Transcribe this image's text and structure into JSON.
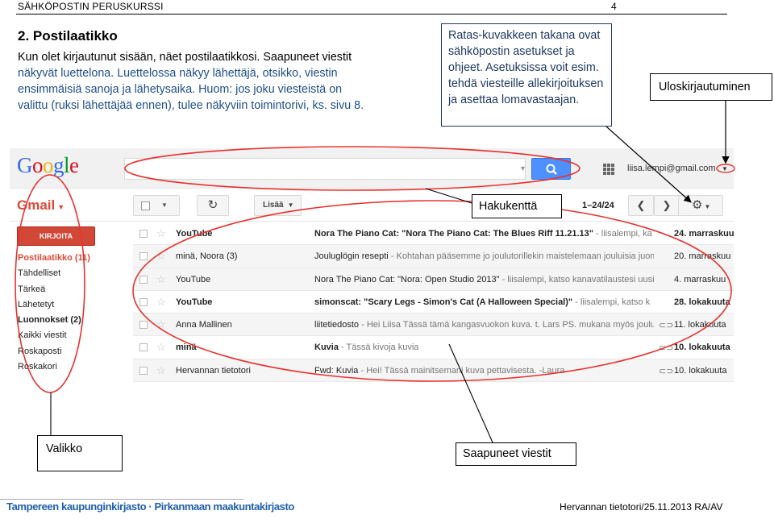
{
  "document": {
    "header_left": "SÄHKÖPOSTIN PERUSKURSSI",
    "page_number": "4",
    "section_title": "2. Postilaatikko",
    "intro_lines": [
      "Kun olet kirjautunut sisään, näet postilaatikkosi. Saapuneet viestit",
      "näkyvät luettelona. Luettelossa näkyy lähettäjä, otsikko, viestin",
      "ensimmäisiä sanoja ja lähetysaika. Huom: jos joku viesteistä on",
      "valittu (ruksi  lähettäjää ennen), tulee näkyviin toimintorivi, ks. sivu 8."
    ],
    "footer_left": "Tampereen kaupunginkirjasto · Pirkanmaan maakuntakirjasto",
    "footer_right": "Hervannan tietotori/25.11.2013 RA/AV"
  },
  "callouts": {
    "ratas": "Ratas-kuvakkeen takana ovat sähköpostin asetukset ja ohjeet. Asetuksissa voit esim. tehdä viesteille allekirjoituksen ja asettaa lomavastaajan.",
    "uloskirjautuminen": "Uloskirjautuminen",
    "hakukentta": "Hakukenttä",
    "valikko": "Valikko",
    "saapuneet": "Saapuneet viestit"
  },
  "gmail": {
    "logo": {
      "g1": "G",
      "o1": "o",
      "o2": "o",
      "g2": "g",
      "l": "l",
      "e": "e"
    },
    "account_email": "liisa.lempi@gmail.com",
    "product_label": "Gmail",
    "more_label": "Lisää",
    "page_count": "1–24/24",
    "compose_label": "KIRJOITA",
    "nav": [
      {
        "label": "Postilaatikko (11)",
        "state": "active"
      },
      {
        "label": "Tähdelliset",
        "state": ""
      },
      {
        "label": "Tärkeä",
        "state": ""
      },
      {
        "label": "Lähetetyt",
        "state": ""
      },
      {
        "label": "Luonnokset (2)",
        "state": "bold"
      },
      {
        "label": "Kaikki viestit",
        "state": ""
      },
      {
        "label": "Roskaposti",
        "state": ""
      },
      {
        "label": "Roskakori",
        "state": ""
      }
    ],
    "messages": [
      {
        "sender": "YouTube",
        "subject": "Nora The Piano Cat: \"Nora The Piano Cat: The Blues Riff 11.21.13\"",
        "snippet": " - liisalempi, ka",
        "date": "24. marraskuu",
        "unread": true,
        "attachment": false
      },
      {
        "sender": "minä, Noora (3)",
        "subject": "Jouluglögin resepti",
        "snippet": " - Kohtahan pääsemme jo joulutorillekin maistelemaan jouluisia juomia",
        "date": "20. marraskuu",
        "unread": false,
        "attachment": false
      },
      {
        "sender": "YouTube",
        "subject": "Nora The Piano Cat: \"Nora: Open Studio 2013\"",
        "snippet": " - liisalempi, katso kanavatilaustesi uusimmat",
        "date": "4. marraskuu",
        "unread": false,
        "attachment": false
      },
      {
        "sender": "YouTube",
        "subject": "simonscat: \"Scary Legs - Simon's Cat (A Halloween Special)\"",
        "snippet": " - liisalempi, katso k",
        "date": "28. lokakuuta",
        "unread": true,
        "attachment": false
      },
      {
        "sender": "Anna Mallinen",
        "subject": "liitetiedosto",
        "snippet": " - Hei Liisa Tässä tämä kangasvuokon kuva. t. Lars PS. mukana myös joulu",
        "date": "11. lokakuuta",
        "unread": false,
        "attachment": true
      },
      {
        "sender": "minä",
        "subject": "Kuvia",
        "snippet": " - Tässä kivoja kuvia",
        "date": "10. lokakuuta",
        "unread": true,
        "attachment": true
      },
      {
        "sender": "Hervannan tietotori",
        "subject": "Fwd: Kuvia",
        "snippet": " - Hei! Tässä mainitsemani kuva pettavisesta. -Laura",
        "date": "10. lokakuuta",
        "unread": false,
        "attachment": true
      }
    ]
  },
  "colors": {
    "gmail_red": "#dd4b39",
    "annotation_red": "#e8312f",
    "search_blue": "#4d90fe",
    "callout_blue": "#1f3864",
    "footer_blue": "#1f5fae"
  },
  "icons": {
    "search": "magnifier-icon",
    "refresh": "refresh-icon",
    "settings": "gear-icon",
    "apps": "apps-grid-icon",
    "star": "star-icon",
    "attachment": "paperclip-icon"
  }
}
